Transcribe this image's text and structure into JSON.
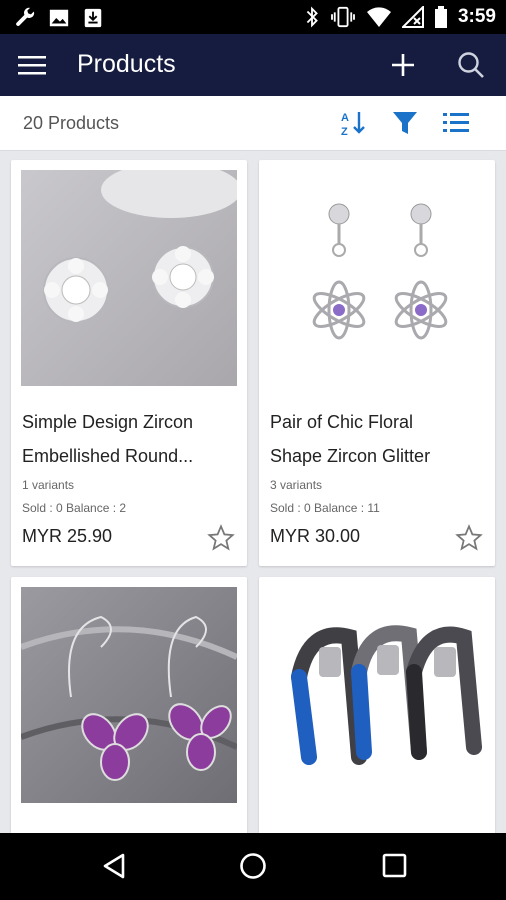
{
  "status_bar": {
    "time": "3:59",
    "left_icons": [
      "wrench-icon",
      "image-icon",
      "download-icon"
    ],
    "right_icons": [
      "bluetooth-icon",
      "vibrate-icon",
      "wifi-icon",
      "no-signal-icon",
      "battery-icon"
    ]
  },
  "app_bar": {
    "title": "Products",
    "background_color": "#161c3f",
    "icons": [
      "menu-icon",
      "add-icon",
      "search-icon"
    ]
  },
  "toolbar": {
    "count_label": "20 Products",
    "accent_color": "#1a73c8",
    "sort_letters": "AZ",
    "icons": [
      "sort-az-icon",
      "filter-icon",
      "list-view-icon"
    ]
  },
  "products": [
    {
      "name_line1": "Simple Design Zircon",
      "name_line2": "Embellished Round...",
      "variants": "1 variants",
      "stock": "Sold : 0  Balance : 2",
      "price": "MYR 25.90",
      "image": "stud-earrings-image"
    },
    {
      "name_line1": "Pair of Chic Floral",
      "name_line2": "Shape Zircon Glitter",
      "variants": "3 variants",
      "stock": "Sold : 0  Balance : 11",
      "price": "MYR 30.00",
      "image": "floral-drop-earrings-image"
    },
    {
      "image": "purple-flower-earrings-image"
    },
    {
      "image": "hand-grip-exercisers-image"
    }
  ],
  "nav_bar": {
    "icons": [
      "back-icon",
      "home-icon",
      "recents-icon"
    ]
  }
}
